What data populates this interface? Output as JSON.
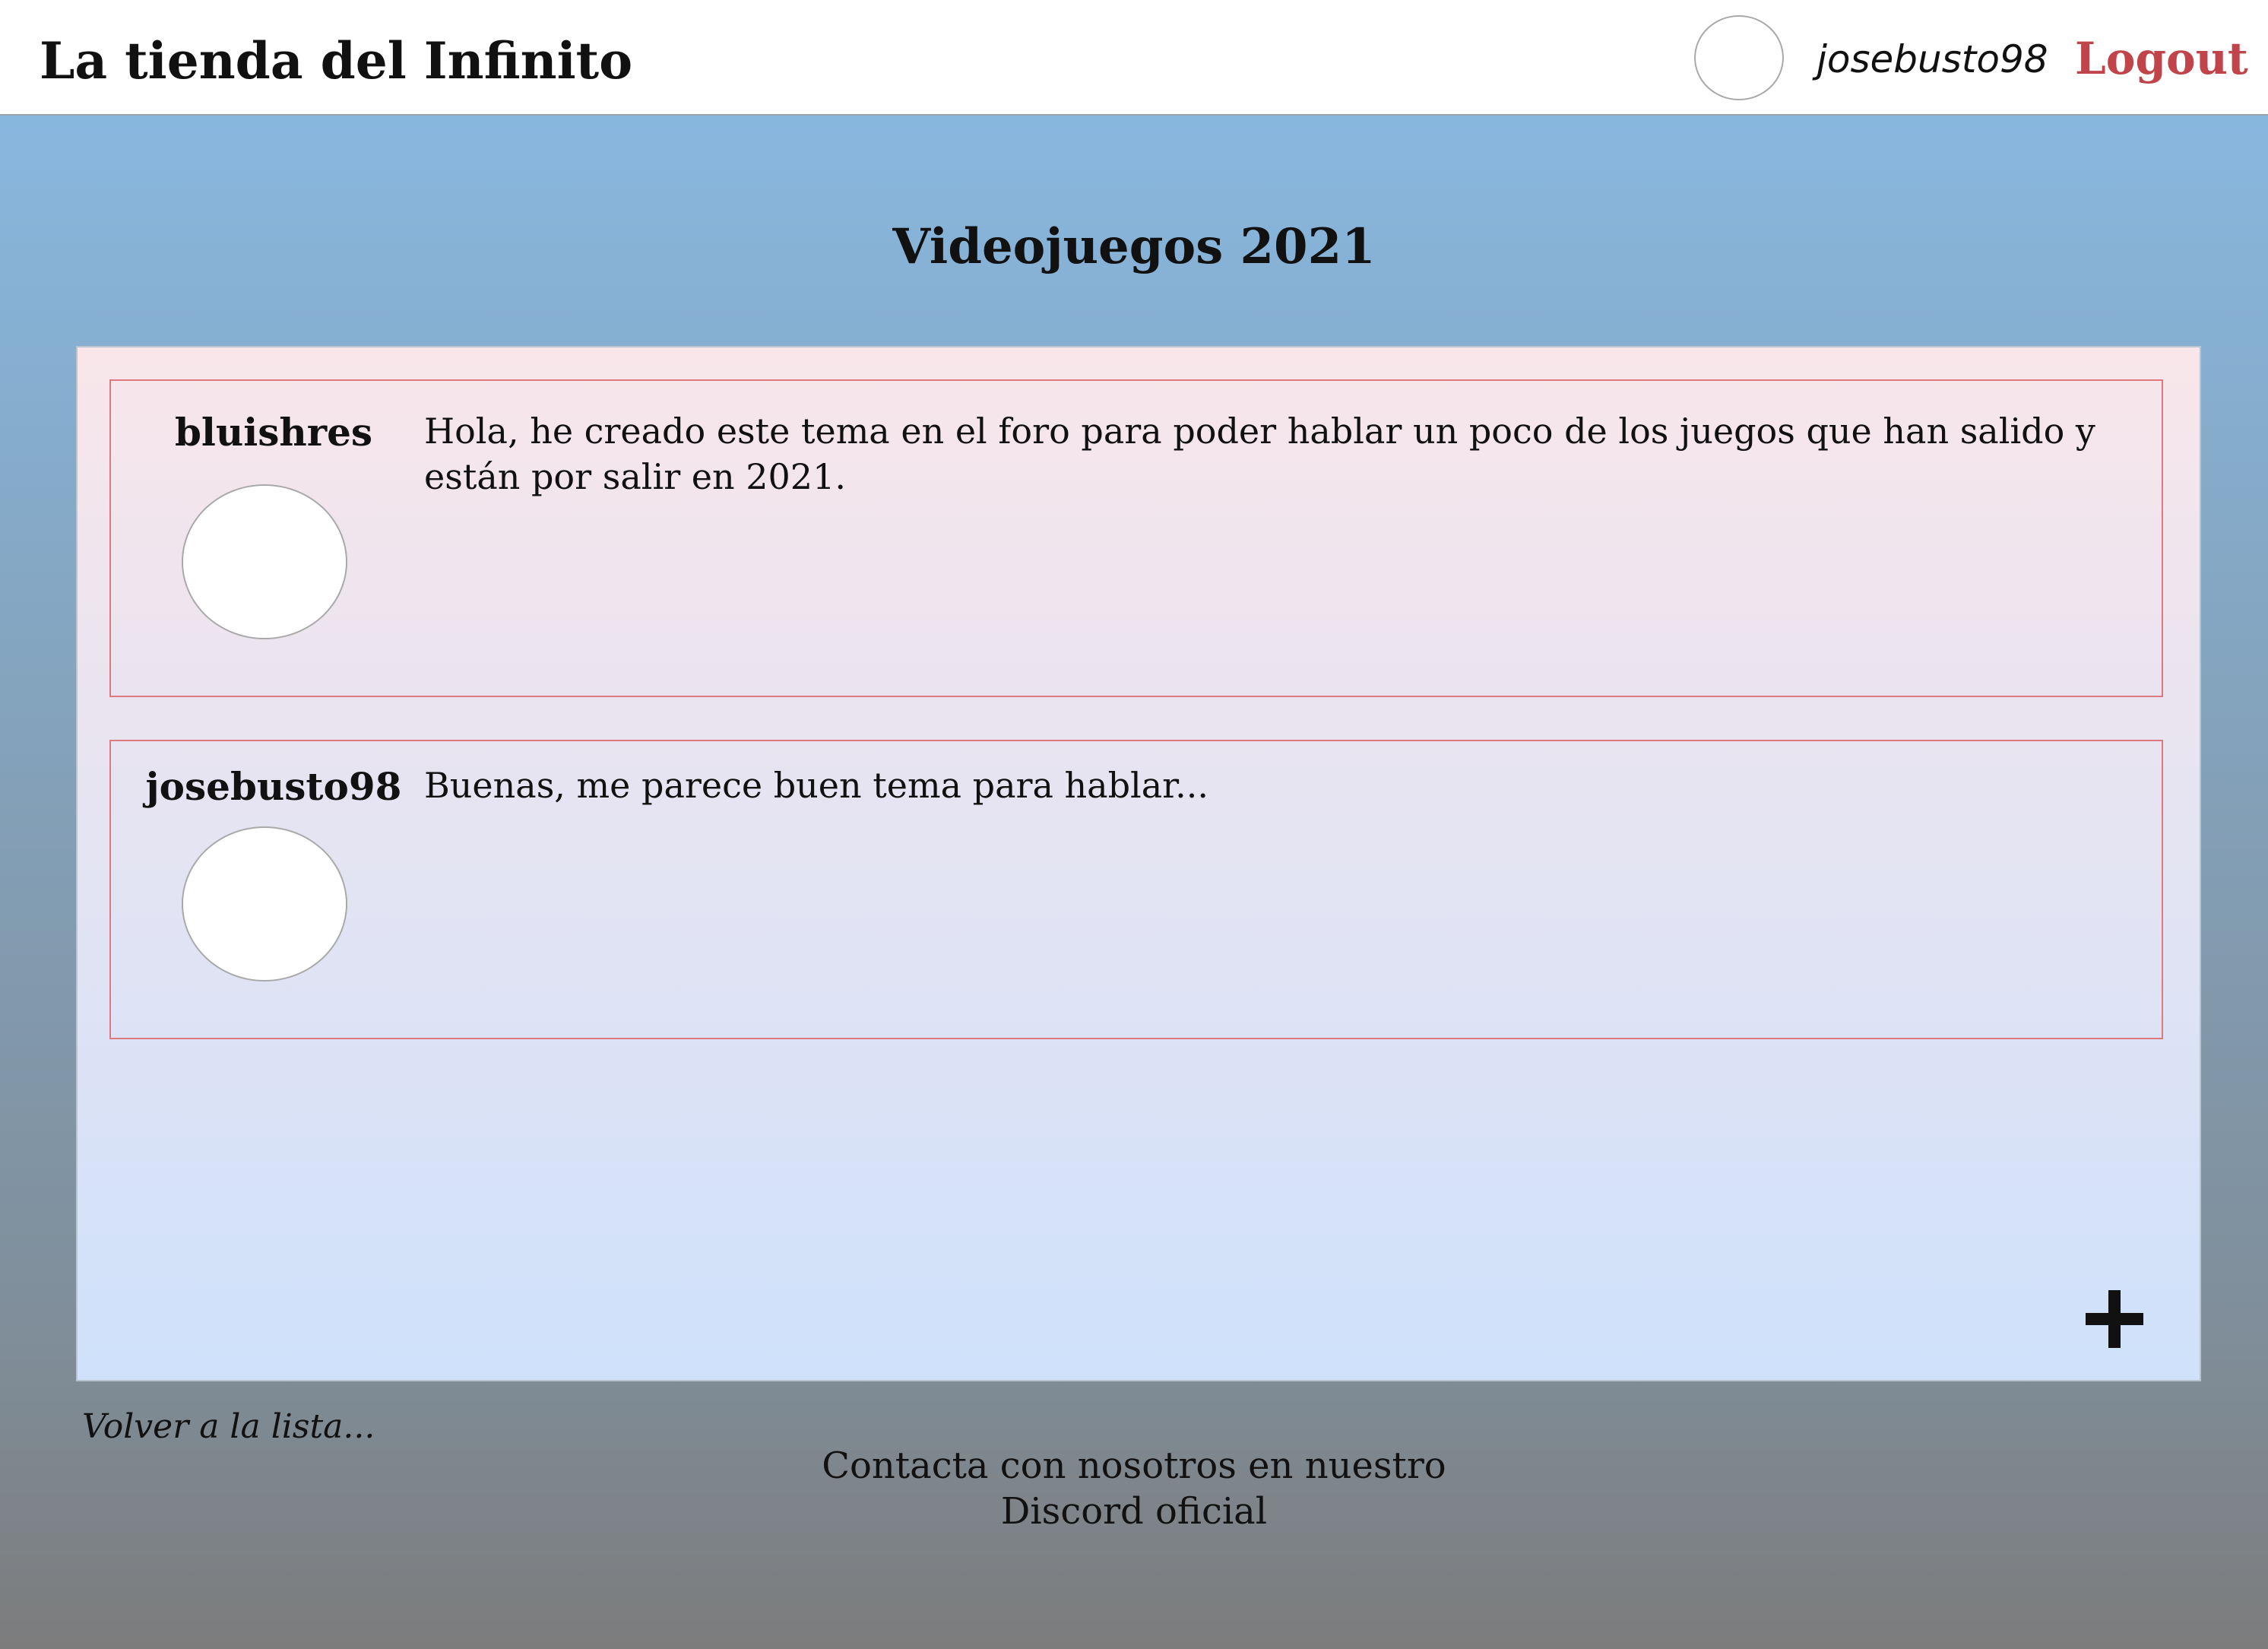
{
  "header": {
    "brand": "La tienda del Infinito",
    "username": "josebusto98",
    "logout_label": "Logout"
  },
  "main": {
    "title": "Videojuegos 2021",
    "posts": [
      {
        "author": "bluishres",
        "text": "Hola, he creado este tema en el foro para poder hablar un poco de los juegos que han salido y están por salir en 2021."
      },
      {
        "author": "josebusto98",
        "text": "Buenas, me parece buen tema para hablar..."
      }
    ],
    "add_icon": "plus-icon"
  },
  "footer": {
    "back_label": "Volver a la lista...",
    "contact_text": "Contacta con nosotros en nuestro Discord oficial"
  },
  "colors": {
    "logout": "#c0444a",
    "post_border": "#dd7a80"
  }
}
